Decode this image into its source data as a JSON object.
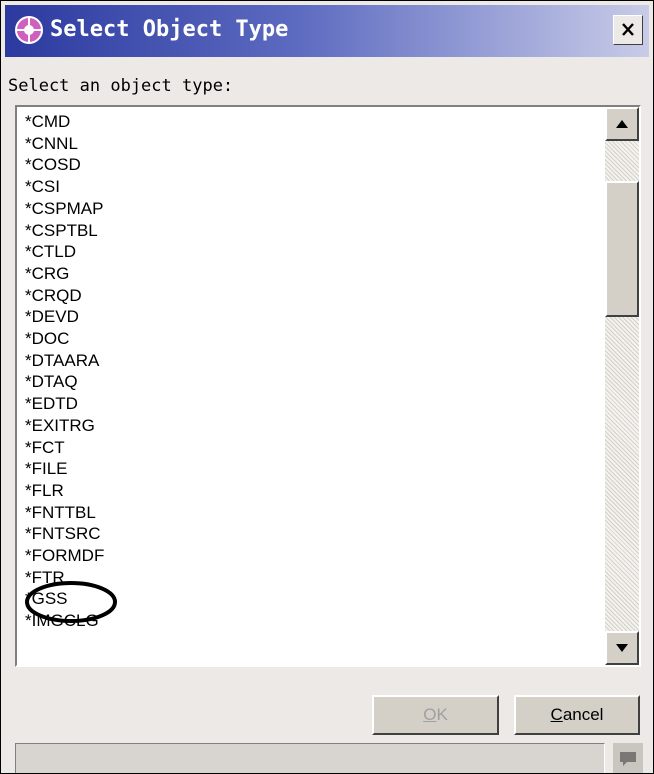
{
  "window": {
    "title": "Select Object Type",
    "close_label": "X"
  },
  "prompt": "Select an object type:",
  "object_types": [
    "*CMD",
    "*CNNL",
    "*COSD",
    "*CSI",
    "*CSPMAP",
    "*CSPTBL",
    "*CTLD",
    "*CRG",
    "*CRQD",
    "*DEVD",
    "*DOC",
    "*DTAARA",
    "*DTAQ",
    "*EDTD",
    "*EXITRG",
    "*FCT",
    "*FILE",
    "*FLR",
    "*FNTTBL",
    "*FNTSRC",
    "*FORMDF",
    "*FTR",
    "*GSS",
    "*IMGCLG"
  ],
  "highlighted_item": "*FILE",
  "buttons": {
    "ok": "OK",
    "ok_enabled": false,
    "cancel": "Cancel"
  },
  "colors": {
    "title_bar": "#2c3aa0",
    "dialog_bg": "#ece9e6",
    "highlight_ellipse": "#000000"
  },
  "icons": {
    "title": "eclipse-plugin-icon",
    "status": "message-bubble-icon"
  }
}
